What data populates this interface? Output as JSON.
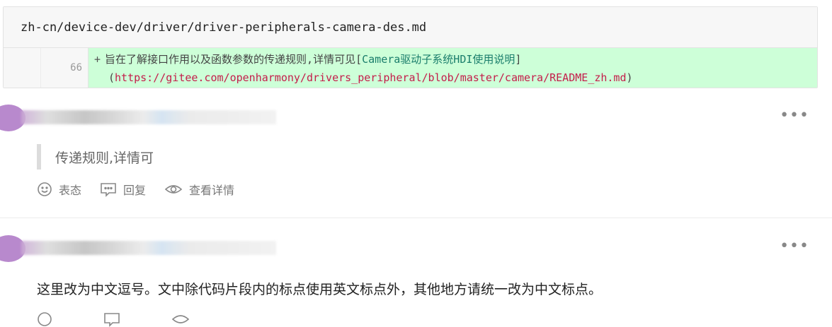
{
  "diff": {
    "file_path": "zh-cn/device-dev/driver/driver-peripherals-camera-des.md",
    "line_number": "66",
    "marker": "+",
    "text_before_link": "旨在了解接口作用以及函数参数的传递规则,详情可见",
    "link_open": "[",
    "link_text": "Camera驱动子系统HDI使用说明",
    "link_close": "]",
    "url_open": "(",
    "url": "https://gitee.com/openharmony/drivers_peripheral/blob/master/camera/README_zh.md",
    "url_close": ")"
  },
  "comments": [
    {
      "quote": "传递规则,详情可",
      "actions": {
        "react": "表态",
        "reply": "回复",
        "view": "查看详情"
      }
    },
    {
      "body": "这里改为中文逗号。文中除代码片段内的标点使用英文标点外，其他地方请统一改为中文标点。"
    }
  ],
  "icons": [
    "smile-icon",
    "reply-icon",
    "eye-icon",
    "more-icon"
  ],
  "colors": {
    "diff_added_bg": "#cdffd8",
    "url": "#c41d4a",
    "link": "#1a7d6b"
  }
}
